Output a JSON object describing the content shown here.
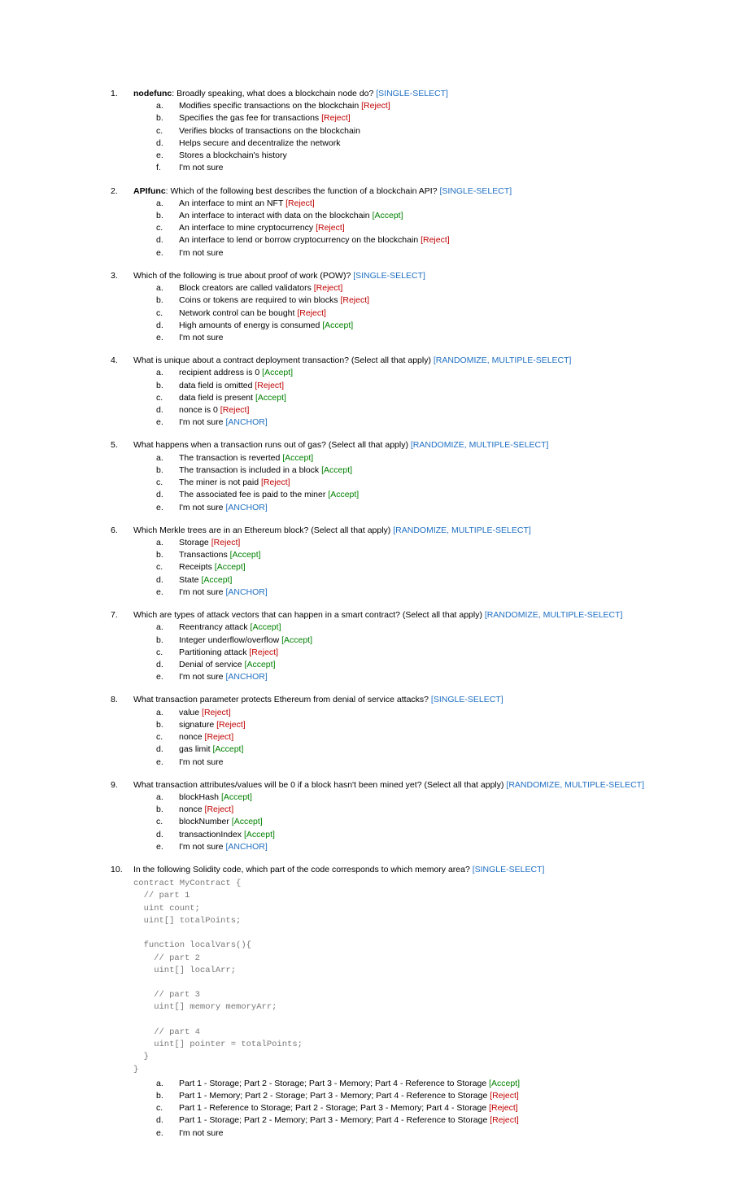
{
  "tags": {
    "single": "[SINGLE-SELECT]",
    "rand_multi": "[RANDOMIZE, MULTIPLE-SELECT]",
    "accept": "[Accept]",
    "reject": "[Reject]",
    "anchor": "[ANCHOR]"
  },
  "q": [
    {
      "stem_bold": "nodefunc",
      "stem_plain": ": Broadly speaking, what does a blockchain node do? ",
      "tag": "single",
      "opts": [
        {
          "t": "Modifies specific transactions on the blockchain ",
          "mark": "reject"
        },
        {
          "t": "Specifies the gas fee for transactions ",
          "mark": "reject"
        },
        {
          "t": "Verifies blocks of transactions on the blockchain",
          "mark": null
        },
        {
          "t": "Helps secure and decentralize the network",
          "mark": null
        },
        {
          "t": "Stores a blockchain's history",
          "mark": null
        },
        {
          "t": "I'm not sure",
          "mark": null
        }
      ]
    },
    {
      "stem_bold": "APIfunc",
      "stem_plain": ": Which of the following best describes the function of a blockchain API? ",
      "tag": "single",
      "opts": [
        {
          "t": "An interface to mint an NFT ",
          "mark": "reject"
        },
        {
          "t": "An interface to interact with data on the blockchain ",
          "mark": "accept"
        },
        {
          "t": "An interface to mine cryptocurrency ",
          "mark": "reject"
        },
        {
          "t": "An interface to lend or borrow cryptocurrency on the blockchain ",
          "mark": "reject"
        },
        {
          "t": "I'm not sure",
          "mark": null
        }
      ]
    },
    {
      "stem_plain": "Which of the following is true about proof of work (POW)? ",
      "tag": "single",
      "opts": [
        {
          "t": "Block creators are called validators ",
          "mark": "reject"
        },
        {
          "t": "Coins or tokens are required to win blocks ",
          "mark": "reject"
        },
        {
          "t": "Network control can be bought ",
          "mark": "reject"
        },
        {
          "t": "High amounts of energy is consumed ",
          "mark": "accept"
        },
        {
          "t": "I'm not sure",
          "mark": null
        }
      ]
    },
    {
      "stem_plain": "What is unique about a contract deployment transaction? (Select all that apply) ",
      "tag": "rand_multi",
      "opts": [
        {
          "pre_bold": "recipient",
          "t": " address is 0 ",
          "mark": "accept"
        },
        {
          "pre_bold": "data",
          "t": " field is omitted ",
          "mark": "reject"
        },
        {
          "pre_bold": "data",
          "t": " field is present ",
          "mark": "accept"
        },
        {
          "pre_bold": "nonce",
          "t": " is 0 ",
          "mark": "reject"
        },
        {
          "t": "I'm not sure ",
          "mark": "anchor"
        }
      ]
    },
    {
      "stem_plain": "What happens when a transaction runs out of gas? (Select all that apply) ",
      "tag": "rand_multi",
      "opts": [
        {
          "t": "The transaction is reverted ",
          "mark": "accept"
        },
        {
          "t": "The transaction is included in a block ",
          "mark": "accept"
        },
        {
          "t": "The miner is not paid ",
          "mark": "reject"
        },
        {
          "t": "The associated fee is paid to the miner ",
          "mark": "accept"
        },
        {
          "t": "I'm not sure ",
          "mark": "anchor"
        }
      ]
    },
    {
      "stem_plain": "Which Merkle trees are in an Ethereum block? (Select all that apply) ",
      "tag": "rand_multi",
      "opts": [
        {
          "t": "Storage ",
          "mark": "reject"
        },
        {
          "t": "Transactions ",
          "mark": "accept"
        },
        {
          "t": "Receipts ",
          "mark": "accept"
        },
        {
          "t": "State ",
          "mark": "accept"
        },
        {
          "t": "I'm not sure ",
          "mark": "anchor"
        }
      ]
    },
    {
      "stem_plain": "Which are types of attack vectors that can happen in a smart contract? (Select all that apply) ",
      "tag": "rand_multi",
      "opts": [
        {
          "t": "Reentrancy attack ",
          "mark": "accept"
        },
        {
          "t": "Integer underflow/overflow ",
          "mark": "accept"
        },
        {
          "t": "Partitioning attack ",
          "mark": "reject"
        },
        {
          "t": "Denial of service ",
          "mark": "accept"
        },
        {
          "t": "I'm not sure ",
          "mark": "anchor"
        }
      ]
    },
    {
      "stem_plain": "What transaction parameter protects Ethereum from denial of service attacks? ",
      "tag": "single",
      "opts": [
        {
          "t": "value ",
          "mark": "reject"
        },
        {
          "t": "signature ",
          "mark": "reject"
        },
        {
          "t": "nonce ",
          "mark": "reject"
        },
        {
          "t": "gas limit ",
          "mark": "accept"
        },
        {
          "t": "I'm not sure",
          "mark": null
        }
      ]
    },
    {
      "stem_plain": "What transaction attributes/values will be 0 if a block hasn't been mined yet? (Select all that apply) ",
      "tag": "rand_multi",
      "opts": [
        {
          "t": "blockHash ",
          "mark": "accept"
        },
        {
          "t": "nonce ",
          "mark": "reject"
        },
        {
          "t": "blockNumber ",
          "mark": "accept"
        },
        {
          "t": "transactionIndex ",
          "mark": "accept"
        },
        {
          "t": "I'm not sure ",
          "mark": "anchor"
        }
      ]
    },
    {
      "stem_plain": "In the following Solidity code, which part of the code corresponds to which memory area? ",
      "tag": "single",
      "code": "contract MyContract {\n  // part 1\n  uint count;\n  uint[] totalPoints;\n\n  function localVars(){\n    // part 2\n    uint[] localArr;\n\n    // part 3\n    uint[] memory memoryArr;\n\n    // part 4\n    uint[] pointer = totalPoints;\n  }\n}",
      "opts": [
        {
          "t": "Part 1 - Storage; Part 2 - Storage; Part 3 - Memory; Part 4 - Reference to Storage ",
          "mark": "accept"
        },
        {
          "t": "Part 1 - Memory; Part 2 - Storage; Part 3 - Memory; Part 4 - Reference to Storage ",
          "mark": "reject"
        },
        {
          "t": "Part 1 - Reference to Storage; Part 2 - Storage; Part 3 - Memory; Part 4 - Storage ",
          "mark": "reject"
        },
        {
          "t": "Part 1 - Storage; Part 2 - Memory; Part 3 - Memory; Part 4 - Reference to Storage ",
          "mark": "reject"
        },
        {
          "t": "I'm not sure",
          "mark": null
        }
      ]
    }
  ]
}
